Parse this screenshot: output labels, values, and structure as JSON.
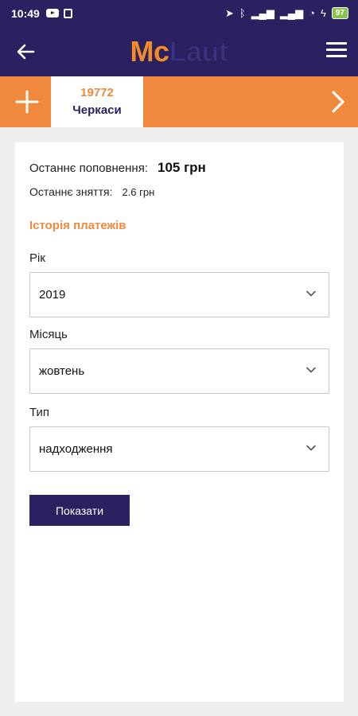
{
  "status_bar": {
    "time": "10:49",
    "battery": "97"
  },
  "app_bar": {
    "logo_mc": "Mc",
    "logo_laut": "Laut"
  },
  "tabs": {
    "active": {
      "number": "19772",
      "city": "Черкаси"
    }
  },
  "balance": {
    "last_topup_label": "Останнє поповнення:",
    "last_topup_value": "105 грн",
    "last_withdrawal_label": "Останнє зняття:",
    "last_withdrawal_value": "2.6 грн"
  },
  "history": {
    "title": "Історія платежів",
    "year_label": "Рік",
    "year_value": "2019",
    "month_label": "Місяць",
    "month_value": "жовтень",
    "type_label": "Тип",
    "type_value": "надходження",
    "show_button": "Показати"
  },
  "colors": {
    "primary": "#2b2060",
    "accent": "#f0883e"
  },
  "icons": {
    "back": "back-arrow-icon",
    "menu": "hamburger-menu-icon",
    "add": "plus-icon",
    "next": "chevron-right-icon",
    "dropdown": "chevron-down-icon"
  }
}
